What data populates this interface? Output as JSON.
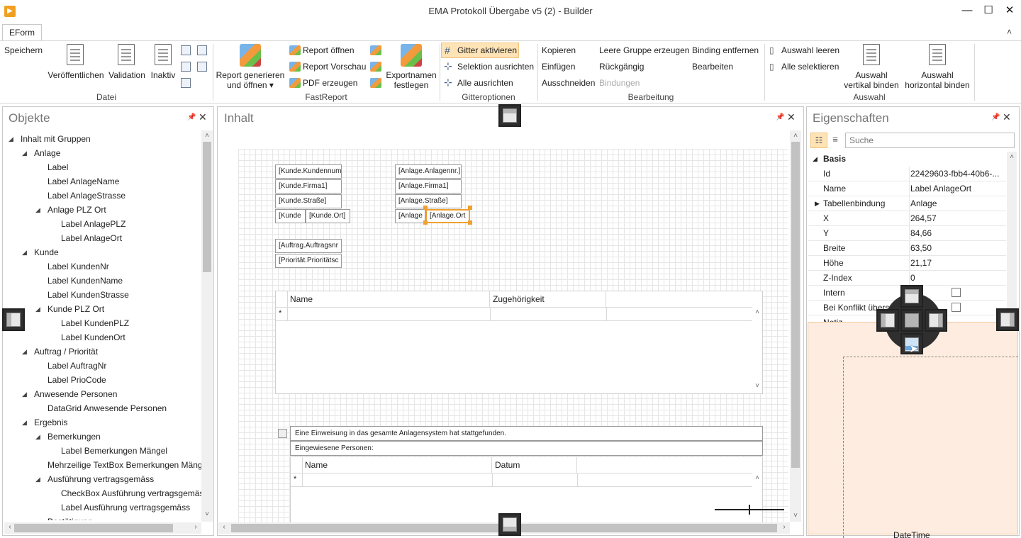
{
  "window": {
    "title": "EMA Protokoll Übergabe v5 (2) - Builder",
    "minimize": "—",
    "maximize": "☐",
    "close": "✕"
  },
  "ribbon": {
    "tab": "EForm",
    "datei": {
      "save": "Speichern",
      "publish": "Veröffentlichen",
      "validation": "Validation",
      "inactive": "Inaktiv",
      "group": "Datei"
    },
    "fastreport": {
      "generate_line1": "Report generieren",
      "generate_line2": "und öffnen",
      "open": "Report öffnen",
      "preview": "Report Vorschau",
      "pdf": "PDF erzeugen",
      "export_line1": "Exportnamen",
      "export_line2": "festlegen",
      "group": "FastReport"
    },
    "gitter": {
      "activate": "Gitter aktivieren",
      "align_selection": "Selektion ausrichten",
      "align_all": "Alle ausrichten",
      "group": "Gitteroptionen"
    },
    "bearbeitung": {
      "copy": "Kopieren",
      "paste": "Einfügen",
      "cut": "Ausschneiden",
      "empty_group": "Leere Gruppe erzeugen",
      "undo": "Rückgängig",
      "bindings": "Bindungen",
      "remove_binding": "Binding entfernen",
      "edit": "Bearbeiten",
      "group": "Bearbeitung"
    },
    "auswahl": {
      "clear": "Auswahl leeren",
      "select_all": "Alle selektieren",
      "vbind_line1": "Auswahl",
      "vbind_line2": "vertikal binden",
      "hbind_line1": "Auswahl",
      "hbind_line2": "horizontal binden",
      "group": "Auswahl"
    }
  },
  "objects_panel": {
    "title": "Objekte",
    "items": [
      {
        "label": "Inhalt mit Gruppen",
        "level": 0,
        "expanded": true
      },
      {
        "label": "Anlage",
        "level": 1,
        "expanded": true
      },
      {
        "label": "Label",
        "level": 2
      },
      {
        "label": "Label AnlageName",
        "level": 2
      },
      {
        "label": "Label AnlageStrasse",
        "level": 2
      },
      {
        "label": "Anlage PLZ Ort",
        "level": 2,
        "expanded": true
      },
      {
        "label": "Label AnlagePLZ",
        "level": 3
      },
      {
        "label": "Label AnlageOrt",
        "level": 3
      },
      {
        "label": "Kunde",
        "level": 1,
        "expanded": true
      },
      {
        "label": "Label KundenNr",
        "level": 2
      },
      {
        "label": "Label KundenName",
        "level": 2
      },
      {
        "label": "Label KundenStrasse",
        "level": 2
      },
      {
        "label": "Kunde PLZ Ort",
        "level": 2,
        "expanded": true
      },
      {
        "label": "Label KundenPLZ",
        "level": 3
      },
      {
        "label": "Label KundenOrt",
        "level": 3
      },
      {
        "label": "Auftrag / Priorität",
        "level": 1,
        "expanded": true
      },
      {
        "label": "Label AuftragNr",
        "level": 2
      },
      {
        "label": "Label PrioCode",
        "level": 2
      },
      {
        "label": "Anwesende Personen",
        "level": 1,
        "expanded": true
      },
      {
        "label": "DataGrid Anwesende Personen",
        "level": 2
      },
      {
        "label": "Ergebnis",
        "level": 1,
        "expanded": true
      },
      {
        "label": "Bemerkungen",
        "level": 2,
        "expanded": true
      },
      {
        "label": "Label Bemerkungen Mängel",
        "level": 3
      },
      {
        "label": "Mehrzeilige TextBox Bemerkungen Mäng",
        "level": 2
      },
      {
        "label": "Ausführung vertragsgemäss",
        "level": 2,
        "expanded": true
      },
      {
        "label": "CheckBox Ausführung vertragsgemäs",
        "level": 3
      },
      {
        "label": "Label Ausführung vertragsgemäss",
        "level": 3
      },
      {
        "label": "Bestätigung",
        "level": 2,
        "expanded": true
      }
    ]
  },
  "content_panel": {
    "title": "Inhalt",
    "fields_kunde": [
      "[Kunde.Kundennum",
      "[Kunde.Firma1]",
      "[Kunde.Straße]",
      "[Kunde",
      "[Kunde.Ort]"
    ],
    "fields_anlage": [
      "[Anlage.Anlagennr.]",
      "[Anlage.Firma1]",
      "[Anlage.Straße]",
      "[Anlage",
      "[Anlage.Ort"
    ],
    "fields_auftrag": [
      "[Auftrag.Auftragsnr",
      "[Priorität.Prioritätsc"
    ],
    "grid1": {
      "col1": "Name",
      "col2": "Zugehörigkeit",
      "new_row": "*"
    },
    "checkbox_label": "Eine Einweisung in das gesamte Anlagensystem hat stattgefunden.",
    "persons_label": "Eingewiesene Personen:",
    "grid2": {
      "col1": "Name",
      "col2": "Datum",
      "new_row": "*"
    }
  },
  "properties_panel": {
    "title": "Eigenschaften",
    "search_placeholder": "Suche",
    "category": "Basis",
    "rows": [
      {
        "name": "Id",
        "value": "22429603-fbb4-40b6-..."
      },
      {
        "name": "Name",
        "value": "Label AnlageOrt"
      },
      {
        "name": "Tabellenbindung",
        "value": "Anlage"
      },
      {
        "name": "X",
        "value": "264,57"
      },
      {
        "name": "Y",
        "value": "84,66"
      },
      {
        "name": "Breite",
        "value": "63,50"
      },
      {
        "name": "Höhe",
        "value": "21,17"
      },
      {
        "name": "Z-Index",
        "value": "0"
      },
      {
        "name": "Intern",
        "value": ""
      },
      {
        "name": "Bei Konflikt überschreiben",
        "value": ""
      },
      {
        "name": "Notiz",
        "value": ""
      }
    ],
    "hidden_text": "DateTime"
  }
}
